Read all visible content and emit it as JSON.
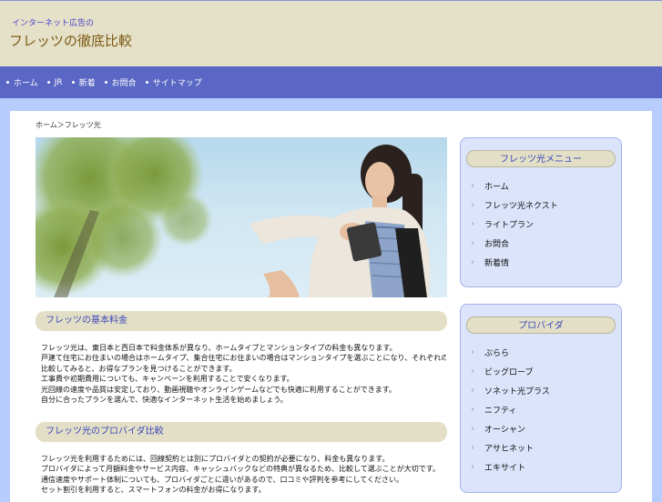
{
  "header": {
    "tagline": "インターネット広告の",
    "title": "フレッツの徹底比較"
  },
  "nav": [
    "ホーム",
    "JR",
    "新着",
    "お問合",
    "サイトマップ"
  ],
  "breadcrumb": "ホーム＞フレッツ光",
  "sections": [
    {
      "heading": "フレッツの基本料金",
      "lines": [
        "フレッツ光は、東日本と西日本で料金体系が異なり、ホームタイプとマンションタイプの料金も異なります。",
        "戸建て住宅にお住まいの場合はホームタイプ、集合住宅にお住まいの場合はマンションタイプを選ぶことになり、それぞれの月額料金やプロバイダ料金について詳しく",
        "比較してみると、お得なプランを見つけることができます。",
        "工事費や初期費用についても、キャンペーンを利用することで安くなります。",
        "光回線の速度や品質は安定しており、動画視聴やオンラインゲームなどでも快適に利用することができます。",
        "自分に合ったプランを選んで、快適なインターネット生活を始めましょう。"
      ]
    },
    {
      "heading": "フレッツ光のプロバイダ比較",
      "lines": [
        "フレッツ光を利用するためには、回線契約とは別にプロバイダとの契約が必要になり、料金も異なります。",
        "プロバイダによって月額料金やサービス内容、キャッシュバックなどの特典が異なるため、比較して選ぶことが大切です。",
        "通信速度やサポート体制についても、プロバイダごとに違いがあるので、口コミや評判を参考にしてください。",
        "セット割引を利用すると、スマートフォンの料金がお得になります。"
      ]
    }
  ],
  "sidebar": [
    {
      "heading": "フレッツ光メニュー",
      "items": [
        "ホーム",
        "フレッツ光ネクスト",
        "ライトプラン",
        "お問合",
        "新着情"
      ]
    },
    {
      "heading": "プロバイダ",
      "items": [
        "ぷらら",
        "ビッグローブ",
        "ソネット光プラス",
        "ニフティ",
        "オーシャン",
        "アサヒネット",
        "エキサイト"
      ]
    }
  ]
}
